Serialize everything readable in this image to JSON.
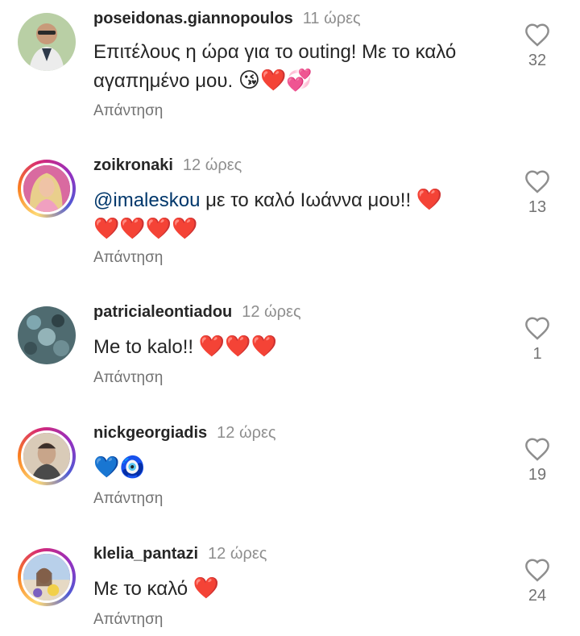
{
  "comments": [
    {
      "username": "poseidonas.giannopoulos",
      "time": "11 ώρες",
      "text": "Επιτέλους η ώρα για το outing! Με το καλό αγαπημένο μου.",
      "emoji": "😘❤️💞",
      "reply": "Απάντηση",
      "likes": "32",
      "has_story_ring": false,
      "avatar_color": "#b7c9a8"
    },
    {
      "username": "zoikronaki",
      "time": "12 ώρες",
      "mention": "@imaleskou",
      "text": "με το καλό Ιωάννα μου!!",
      "emoji": "❤️",
      "emoji2": "❤️❤️❤️❤️",
      "reply": "Απάντηση",
      "likes": "13",
      "has_story_ring": true,
      "avatar_color": "#e8b7b0"
    },
    {
      "username": "patricialeontiadou",
      "time": "12 ώρες",
      "text": "Me to kalo!!",
      "emoji": "❤️❤️❤️",
      "reply": "Απάντηση",
      "likes": "1",
      "has_story_ring": false,
      "avatar_color": "#5f7f86"
    },
    {
      "username": "nickgeorgiadis",
      "time": "12 ώρες",
      "text": "",
      "emoji": "💙🧿",
      "reply": "Απάντηση",
      "likes": "19",
      "has_story_ring": true,
      "avatar_color": "#c9b39a"
    },
    {
      "username": "klelia_pantazi",
      "time": "12 ώρες",
      "text": "Με το καλό",
      "emoji": "❤️",
      "reply": "Απάντηση",
      "likes": "24",
      "has_story_ring": true,
      "avatar_color": "#9bb8d8"
    }
  ],
  "icons": {
    "like": "heart-outline-icon"
  },
  "colors": {
    "username": "#262626",
    "secondary": "#8e8e8e",
    "mention": "#00376b"
  }
}
